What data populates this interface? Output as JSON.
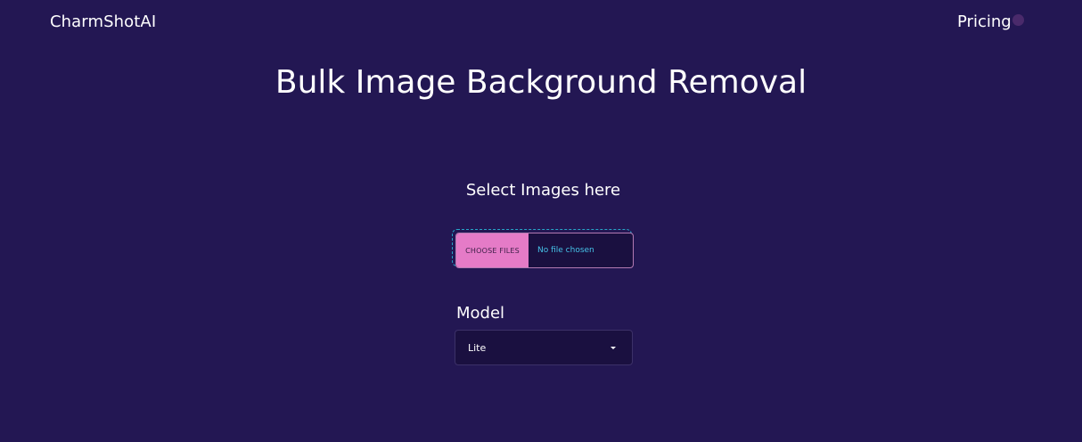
{
  "header": {
    "brand": "CharmShotAI",
    "nav": {
      "pricing_label": "Pricing"
    }
  },
  "main": {
    "title": "Bulk Image Background Removal",
    "upload": {
      "label": "Select Images here",
      "button_label": "CHOOSE FILES",
      "status_text": "No file chosen"
    },
    "model": {
      "label": "Model",
      "selected": "Lite"
    }
  },
  "colors": {
    "background": "#231753",
    "button_accent": "#e57bc7",
    "dashed_border": "#27a5c9",
    "status_text": "#46c2e8"
  }
}
